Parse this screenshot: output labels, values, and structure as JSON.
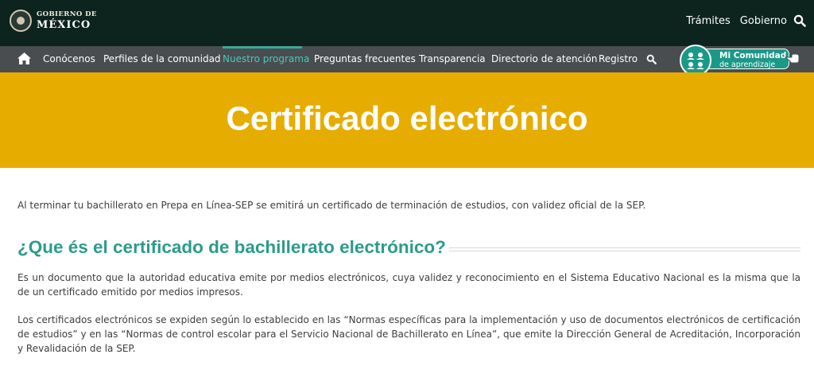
{
  "gov_header": {
    "logo_small": "GOBIERNO DE",
    "logo_big": "MÉXICO",
    "links": [
      "Trámites",
      "Gobierno"
    ],
    "search_icon": "search-icon"
  },
  "nav": {
    "home_icon": "home-icon",
    "items": [
      "Conócenos",
      "Perfiles de la comunidad",
      "Nuestro programa",
      "Preguntas frecuentes",
      "Transparencia",
      "Directorio de atención",
      "Registro"
    ],
    "active_item": "Nuestro programa",
    "search_icon": "search-icon",
    "comunidad_title": "Mi Comunidad",
    "comunidad_sub": "de aprendizaje"
  },
  "hero": {
    "title": "Certificado electrónico"
  },
  "content": {
    "intro": "Al terminar tu bachillerato en Prepa en Línea-SEP se emitirá un certificado de terminación de estudios, con validez oficial de la SEP.",
    "section_title": "¿Que és el certificado de bachillerato electrónico?",
    "paragraph1": "Es un documento que la autoridad educativa emite por medios electrónicos, cuya validez y reconocimiento en el Sistema Educativo Nacional es la misma que la de un certificado emitido por medios impresos.",
    "paragraph2": "Los certificados electrónicos se expiden según lo establecido en las “Normas específicas para la implementación y uso de documentos electrónicos de certificación de estudios” y en las “Normas de control escolar para el Servicio Nacional de Bachillerato en Línea”, que emite la Dirección General de Acreditación, Incorporación y Revalidación de la SEP."
  },
  "colors": {
    "gov_bar": "#0c231e",
    "nav_bar": "#494d50",
    "active_nav": "#49c9b6",
    "hero": "#e6ad00",
    "section_title": "#2a9c8a",
    "comunidad": "#1b9987"
  }
}
